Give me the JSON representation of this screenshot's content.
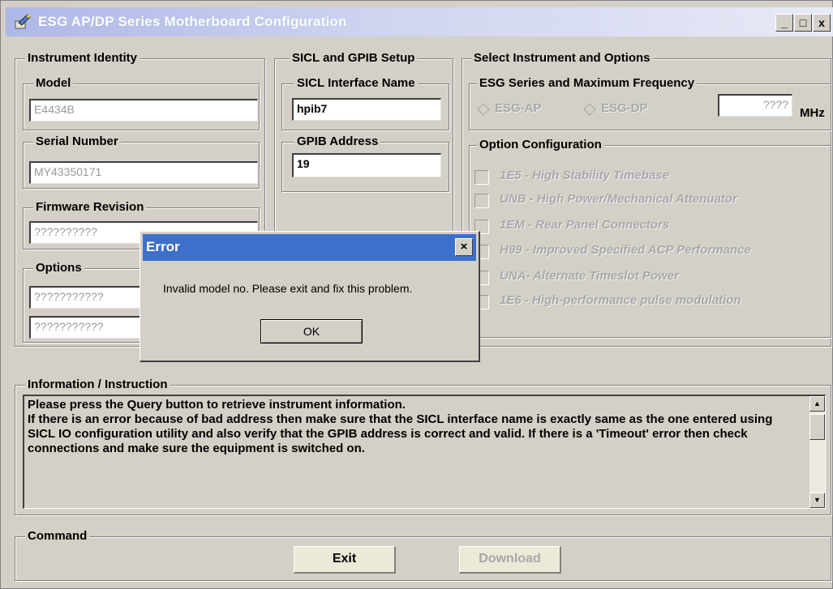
{
  "window": {
    "title": "ESG AP/DP Series Motherboard Configuration",
    "minimize": "_",
    "maximize": "□",
    "close": "x"
  },
  "instrument_identity": {
    "label": "Instrument Identity",
    "model_label": "Model",
    "model_value": "E4434B",
    "serial_label": "Serial Number",
    "serial_value": "MY43350171",
    "firmware_label": "Firmware Revision",
    "firmware_value": "??????????",
    "options_label": "Options",
    "options_values": [
      "???????????",
      "???????????"
    ]
  },
  "sicl_gpib": {
    "label": "SICL and GPIB Setup",
    "interface_label": "SICL Interface Name",
    "interface_value": "hpib7",
    "address_label": "GPIB Address",
    "address_value": "19"
  },
  "select_instrument": {
    "label": "Select Instrument and Options",
    "series_label": "ESG Series and Maximum Frequency",
    "radio_ap": "ESG-AP",
    "radio_dp": "ESG-DP",
    "frequency_value": "????",
    "frequency_unit": "MHz",
    "option_config_label": "Option Configuration",
    "options": [
      "1E5 - High Stability Timebase",
      "UNB - High Power/Mechanical Attenuator",
      "1EM - Rear Panel Connectors",
      "H99 - Improved Specified ACP Performance",
      "UNA- Alternate Timeslot Power",
      "1E6 - High-performance pulse modulation"
    ]
  },
  "information": {
    "label": "Information / Instruction",
    "text": "Please press the Query button to retrieve instrument information.\nIf there is an error because of bad address then make sure that the SICL interface name is exactly same as the one entered using SICL IO configuration utility and also verify that the GPIB address is correct and valid. If there is a 'Timeout' error then check connections and make sure the equipment is switched on."
  },
  "command": {
    "label": "Command",
    "exit_label": "Exit",
    "download_label": "Download"
  },
  "error_dialog": {
    "title": "Error",
    "close": "×",
    "message": "Invalid model no. Please exit and fix this problem.",
    "ok_label": "OK"
  },
  "colors": {
    "dialog_title": "#3d6fcb",
    "face": "#d4d0c8",
    "disabled_text": "#a8a8a8"
  }
}
